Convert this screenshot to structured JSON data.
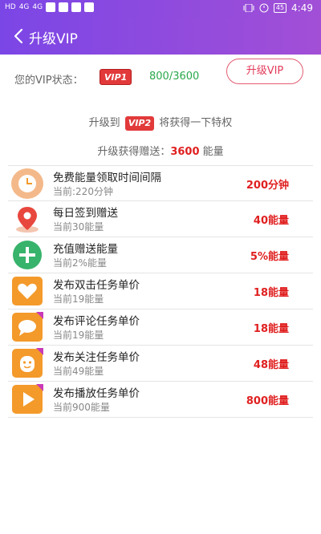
{
  "status_bar": {
    "left_text": [
      "HD",
      "4G",
      "4G",
      "HD"
    ],
    "battery": "45",
    "time": "4:49"
  },
  "app_bar": {
    "title": "升级VIP"
  },
  "vip_status": {
    "label": "您的VIP状态：",
    "badge": "VIP1",
    "progress": "800/3600",
    "upgrade_button": "升级VIP"
  },
  "benefits": {
    "head_prefix": "升级到",
    "head_badge": "VIP2",
    "head_suffix": "将获得一下特权",
    "reward_label": "升级获得赠送：",
    "reward_value": "3600",
    "reward_unit": " 能量",
    "items": [
      {
        "icon": "clock-icon",
        "title": "免费能量领取时间间隔",
        "current": "当前:220分钟",
        "value": "200分钟"
      },
      {
        "icon": "location-pin-icon",
        "title": "每日签到赠送",
        "current": "当前30能量",
        "value": "40能量"
      },
      {
        "icon": "plus-icon",
        "title": "充值赠送能量",
        "current": "当前2%能量",
        "value": "5%能量"
      },
      {
        "icon": "heart-icon",
        "title": "发布双击任务单价",
        "current": "当前19能量",
        "value": "18能量"
      },
      {
        "icon": "comment-icon",
        "title": "发布评论任务单价",
        "current": "当前19能量",
        "value": "18能量"
      },
      {
        "icon": "follow-icon",
        "title": "发布关注任务单价",
        "current": "当前49能量",
        "value": "48能量"
      },
      {
        "icon": "play-icon",
        "title": "发布播放任务单价",
        "current": "当前900能量",
        "value": "800能量"
      }
    ]
  },
  "colors": {
    "accent_purple": "#8a4be0",
    "badge_red": "#e23a3a",
    "value_red": "#e02020",
    "progress_green": "#2aa84a",
    "icon_orange": "#f39a2b",
    "icon_green": "#37b36b"
  }
}
